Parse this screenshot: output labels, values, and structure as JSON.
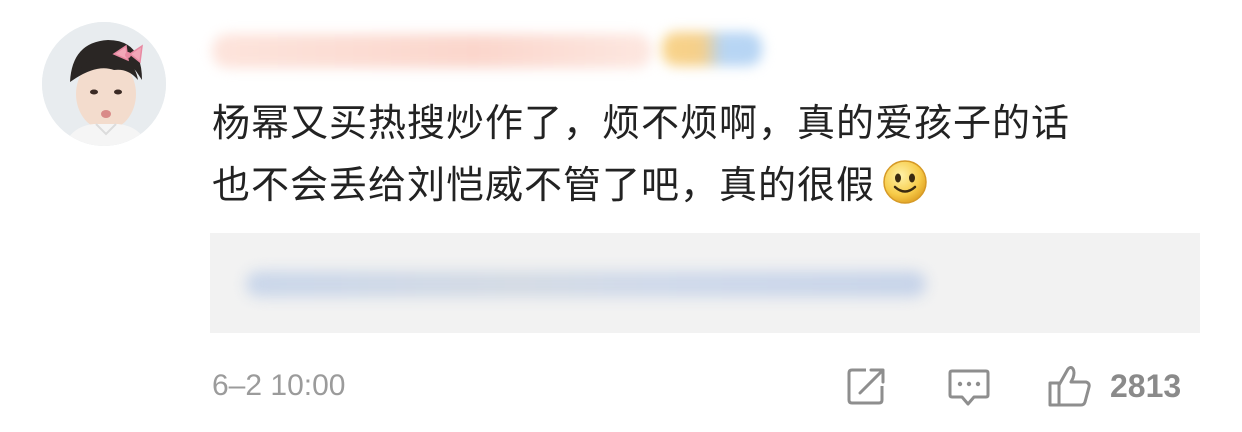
{
  "comment": {
    "line1": "杨幂又买热搜炒作了，烦不烦啊，真的爱孩子的话",
    "line2": "也不会丢给刘恺威不管了吧，真的很假",
    "emoji": "smiley-icon"
  },
  "meta": {
    "time": "6–2 10:00",
    "likes": "2813"
  },
  "icons": {
    "share": "share-icon",
    "comment": "comment-icon",
    "like": "thumbs-up-icon"
  },
  "colors": {
    "text": "#222222",
    "secondary": "#9b9b9b",
    "reply_bg": "#f2f2f2"
  }
}
